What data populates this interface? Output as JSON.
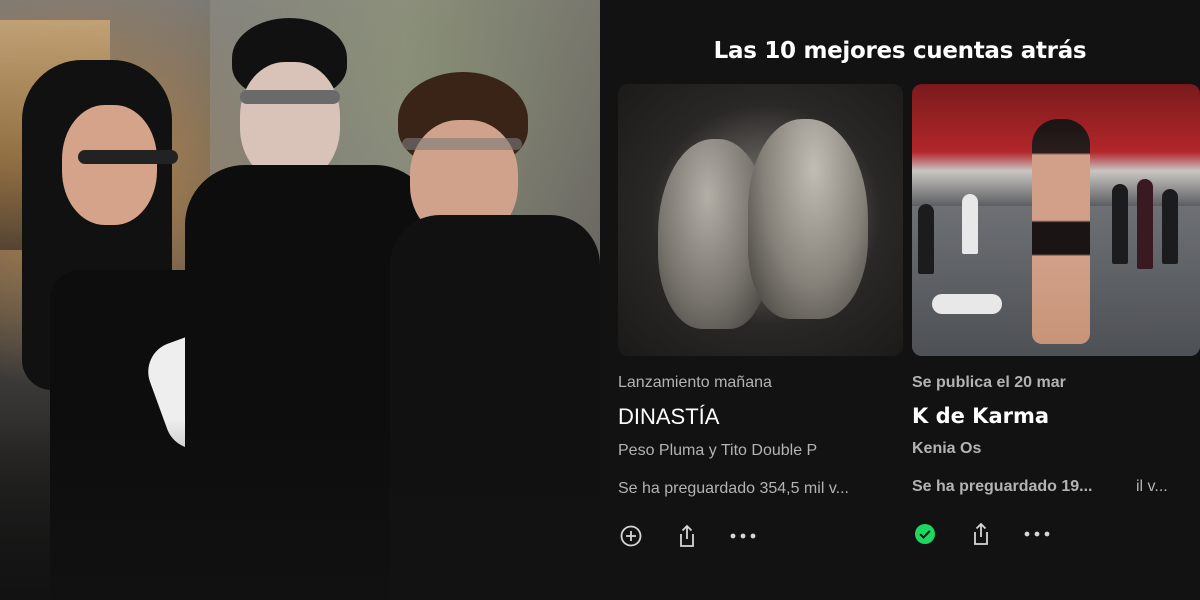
{
  "section": {
    "title": "Las 10 mejores cuentas atrás"
  },
  "cards": [
    {
      "release_label": "Lanzamiento mañana",
      "title": "DINASTÍA",
      "artist": "Peso Pluma y Tito Double P",
      "presaves": "Se ha preguardado 354,5 mil v...",
      "actions": [
        "add-icon",
        "share-icon",
        "more-icon"
      ],
      "saved": false
    },
    {
      "release_label": "Se publica el 20 mar",
      "title": "K de Karma",
      "artist": "Kenia Os",
      "presaves": "Se ha preguardado 19...",
      "presaves_tail": "il v...",
      "actions": [
        "saved-check-icon",
        "share-icon",
        "more-icon"
      ],
      "saved": true
    }
  ],
  "colors": {
    "background": "#121212",
    "text_primary": "#ffffff",
    "text_secondary": "#b3b3b3",
    "accent_green": "#1ed760"
  }
}
